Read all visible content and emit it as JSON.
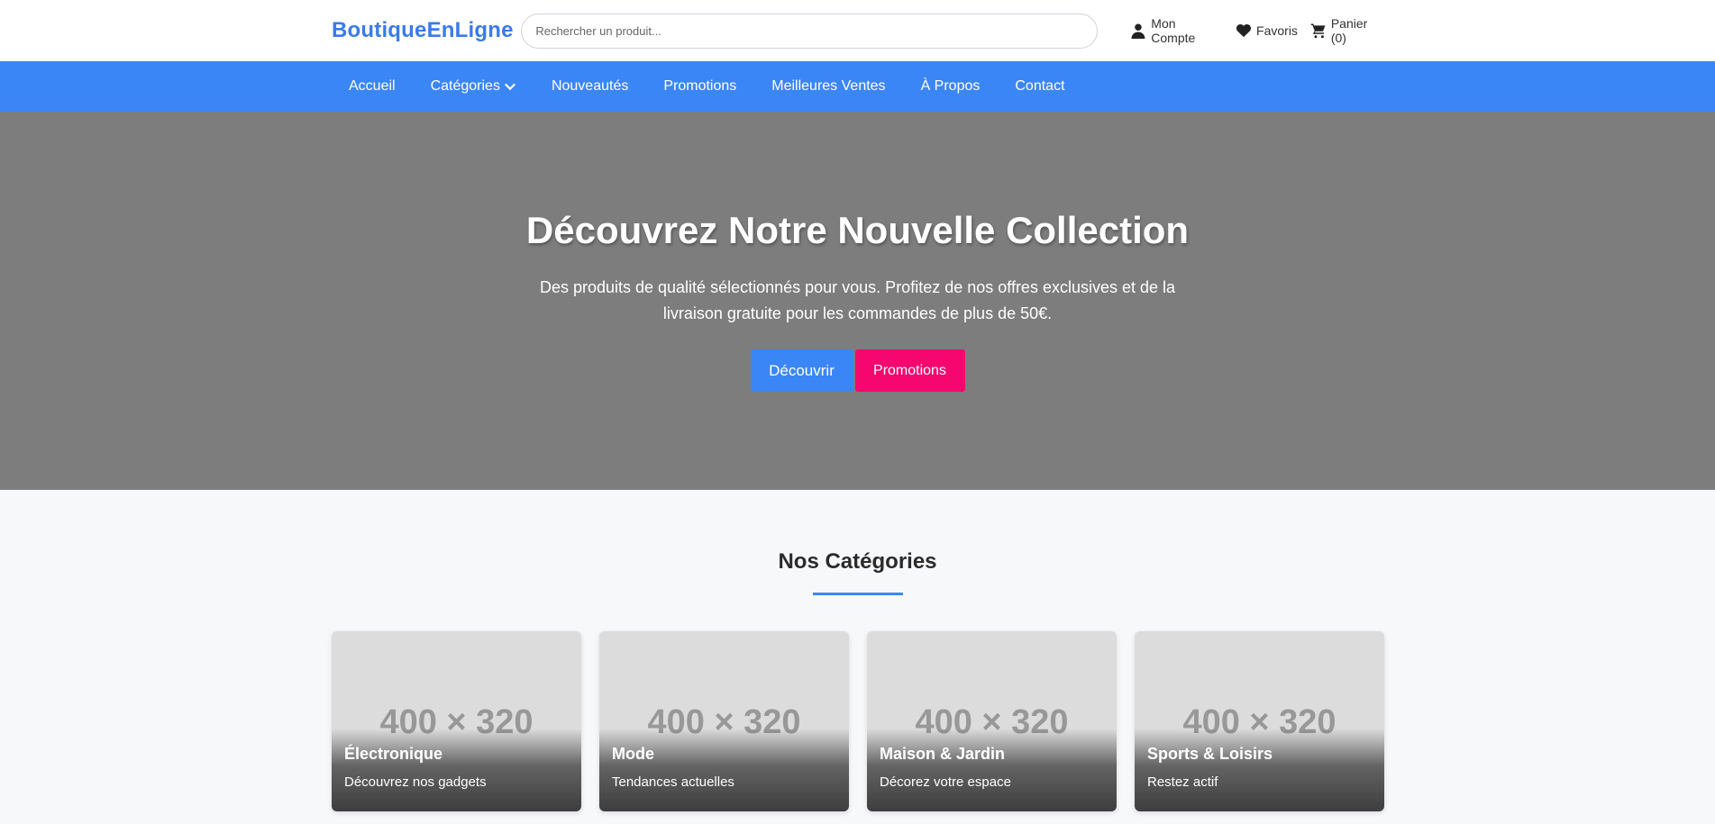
{
  "header": {
    "logo": "BoutiqueEnLigne",
    "search_placeholder": "Rechercher un produit...",
    "actions": [
      {
        "icon": "user-icon",
        "label": "Mon Compte"
      },
      {
        "icon": "heart-icon",
        "label": "Favoris"
      },
      {
        "icon": "cart-icon",
        "label": "Panier (0)"
      }
    ]
  },
  "nav": {
    "items": [
      {
        "label": "Accueil"
      },
      {
        "label": "Catégories",
        "has_dropdown": true
      },
      {
        "label": "Nouveautés"
      },
      {
        "label": "Promotions"
      },
      {
        "label": "Meilleures Ventes"
      },
      {
        "label": "À Propos"
      },
      {
        "label": "Contact"
      }
    ]
  },
  "hero": {
    "title": "Découvrez Notre Nouvelle Collection",
    "text": "Des produits de qualité sélectionnés pour vous. Profitez de nos offres exclusives et de la livraison gratuite pour les commandes de plus de 50€.",
    "primary_button": "Découvrir",
    "secondary_button": "Promotions"
  },
  "categories": {
    "title": "Nos Catégories",
    "items": [
      {
        "placeholder": "400 × 320",
        "name": "Électronique",
        "desc": "Découvrez nos gadgets"
      },
      {
        "placeholder": "400 × 320",
        "name": "Mode",
        "desc": "Tendances actuelles"
      },
      {
        "placeholder": "400 × 320",
        "name": "Maison & Jardin",
        "desc": "Décorez votre espace"
      },
      {
        "placeholder": "400 × 320",
        "name": "Sports & Loisirs",
        "desc": "Restez actif"
      }
    ]
  },
  "colors": {
    "brand": "#3a7be8",
    "nav_bg": "#3b86f6",
    "hero_bg": "#7d7d7d",
    "promo_pink": "#f5076f"
  }
}
